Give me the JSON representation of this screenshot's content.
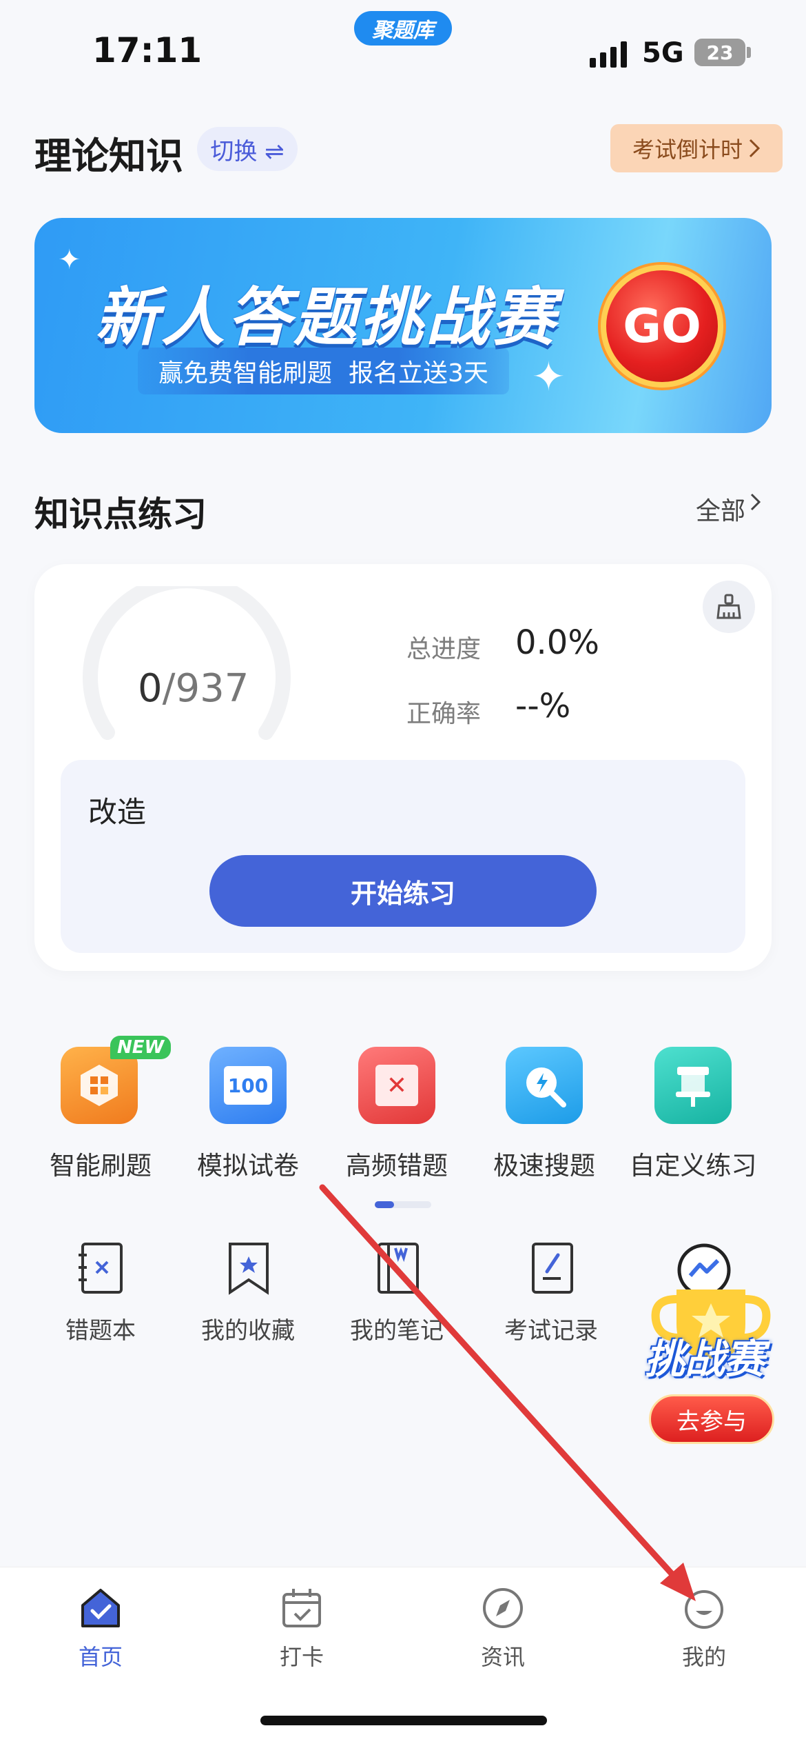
{
  "status_bar": {
    "time": "17:11",
    "app_name": "聚题库",
    "network": "5G",
    "battery": "23"
  },
  "header": {
    "title": "理论知识",
    "switch_label": "切换 ⇌",
    "countdown_label": "考试倒计时"
  },
  "banner": {
    "title": "新人答题挑战赛",
    "sub_left": "赢免费智能刷题",
    "sub_right": "报名立送3天",
    "go_label": "GO"
  },
  "knowledge": {
    "section_title": "知识点练习",
    "all_label": "全部",
    "done": "0",
    "total": "937",
    "progress_label": "总进度",
    "progress_value": "0.0%",
    "progress_fraction": 0,
    "accuracy_label": "正确率",
    "accuracy_value": "--%",
    "practice_name": "改造",
    "start_button": "开始练习"
  },
  "features": {
    "new_badge": "NEW",
    "items": [
      {
        "label": "智能刷题",
        "icon": "smart-practice-icon",
        "color": "#f6942c"
      },
      {
        "label": "模拟试卷",
        "icon": "mock-paper-icon",
        "color": "#3f8ef6"
      },
      {
        "label": "高频错题",
        "icon": "frequent-mistakes-icon",
        "color": "#f24d4d"
      },
      {
        "label": "极速搜题",
        "icon": "quick-search-icon",
        "color": "#29a8f2"
      },
      {
        "label": "自定义练习",
        "icon": "custom-practice-icon",
        "color": "#1fc2b0"
      }
    ],
    "mock_icon_text": "100"
  },
  "tools": {
    "items": [
      {
        "label": "错题本",
        "icon": "mistake-book-icon"
      },
      {
        "label": "我的收藏",
        "icon": "bookmark-icon"
      },
      {
        "label": "我的笔记",
        "icon": "notes-icon"
      },
      {
        "label": "考试记录",
        "icon": "exam-record-icon"
      }
    ]
  },
  "challenge": {
    "title": "挑战赛",
    "join_label": "去参与"
  },
  "nav": {
    "items": [
      {
        "label": "首页",
        "icon": "home-icon",
        "active": true
      },
      {
        "label": "打卡",
        "icon": "calendar-check-icon",
        "active": false
      },
      {
        "label": "资讯",
        "icon": "compass-icon",
        "active": false
      },
      {
        "label": "我的",
        "icon": "profile-icon",
        "active": false
      }
    ]
  },
  "colors": {
    "accent": "#4464d8",
    "annotation_arrow": "#e03a3a"
  }
}
